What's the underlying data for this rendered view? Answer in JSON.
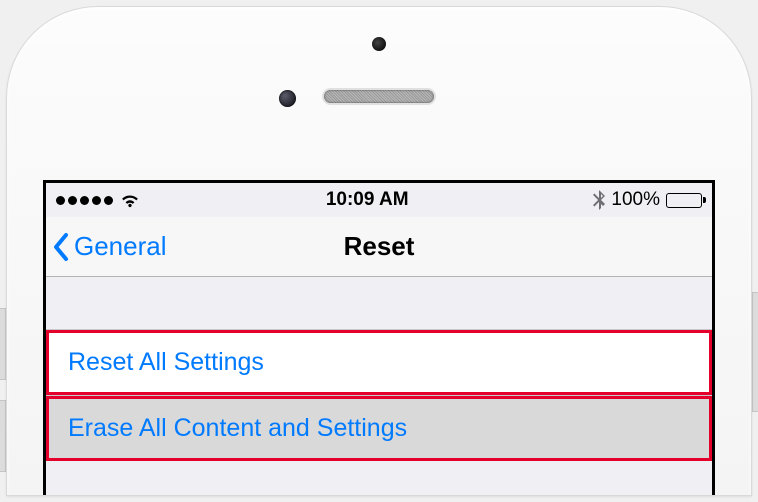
{
  "status": {
    "time": "10:09 AM",
    "battery_text": "100%"
  },
  "nav": {
    "back_label": "General",
    "title": "Reset"
  },
  "list": {
    "items": [
      {
        "label": "Reset All Settings"
      },
      {
        "label": "Erase All Content and Settings"
      }
    ]
  }
}
